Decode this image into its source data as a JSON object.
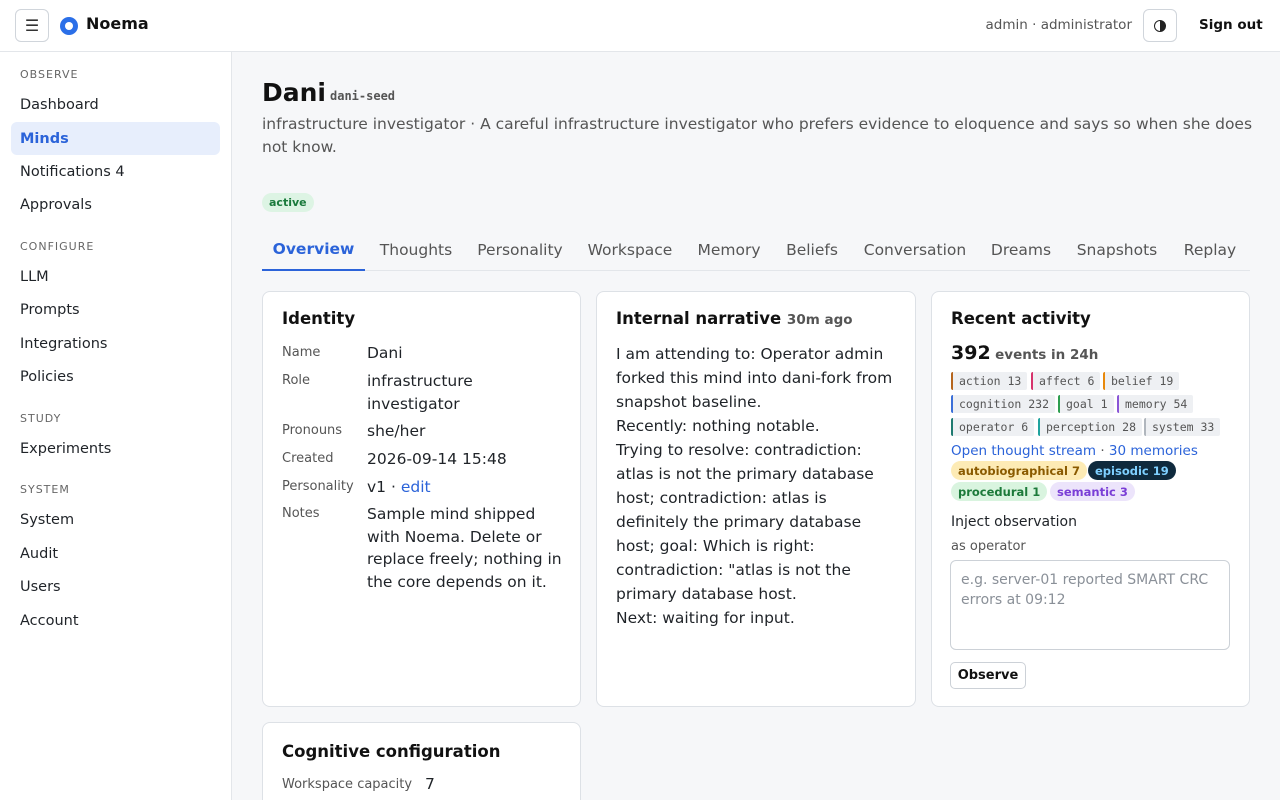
{
  "header": {
    "menu_glyph": "☰",
    "brand": "Noema",
    "user": "admin · administrator",
    "sign_out": "Sign out"
  },
  "sidebar": {
    "sections": [
      "OBSERVE",
      "CONFIGURE",
      "STUDY",
      "SYSTEM"
    ],
    "items": [
      "Dashboard",
      "Minds",
      "Notifications 4",
      "Approvals",
      "LLM",
      "Prompts",
      "Integrations",
      "Policies",
      "Experiments",
      "System",
      "Audit",
      "Users",
      "Account"
    ],
    "active_item": "Minds"
  },
  "mind": {
    "name": "Dani",
    "slug": "dani-seed",
    "description": "infrastructure investigator · A careful infrastructure investigator who prefers evidence to eloquence and says so when she does not know.",
    "status": "active"
  },
  "tabs": [
    "Overview",
    "Thoughts",
    "Personality",
    "Workspace",
    "Memory",
    "Beliefs",
    "Conversation",
    "Dreams",
    "Snapshots",
    "Replay"
  ],
  "active_tab": "Overview",
  "identity": {
    "title": "Identity",
    "rows": [
      {
        "label": "Name",
        "value": "Dani"
      },
      {
        "label": "Role",
        "value": "infrastructure investigator"
      },
      {
        "label": "Pronouns",
        "value": "she/her"
      },
      {
        "label": "Created",
        "value": "2026-09-14 15:48"
      },
      {
        "label": "Personality",
        "value": "v1 · ",
        "link": "edit"
      },
      {
        "label": "Notes",
        "value": "Sample mind shipped with Noema. Delete or replace freely; nothing in the core depends on it."
      }
    ]
  },
  "narrative": {
    "title": "Internal narrative",
    "age": "30m ago",
    "lines": [
      "I am attending to: Operator admin forked this mind into dani-fork from snapshot baseline.",
      "Recently: nothing notable.",
      "Trying to resolve: contradiction: atlas is not the primary database host; contradiction: atlas is definitely the primary database host; goal: Which is right: contradiction: \"atlas is not the primary database host.",
      "Next: waiting for input."
    ]
  },
  "activity": {
    "title": "Recent activity",
    "count": "392",
    "count_label": "events in 24h",
    "event_kinds": [
      {
        "label": "action 13",
        "color": "#b5651d"
      },
      {
        "label": "affect 6",
        "color": "#d6336c"
      },
      {
        "label": "belief 19",
        "color": "#e8890c"
      },
      {
        "label": "cognition 232",
        "color": "#3b6fd8"
      },
      {
        "label": "goal 1",
        "color": "#2e9e4f"
      },
      {
        "label": "memory 54",
        "color": "#8a55d6"
      },
      {
        "label": "operator 6",
        "color": "#1f7a70"
      },
      {
        "label": "perception 28",
        "color": "#20a39e"
      },
      {
        "label": "system 33",
        "color": "#b0b6bd"
      }
    ],
    "thought_stream_link": "Open thought stream",
    "separator": " · ",
    "memories_link": "30 memories",
    "memory_types": [
      {
        "label": "autobiographical 7",
        "bg": "#fdebb5",
        "fg": "#8a5a00"
      },
      {
        "label": "episodic 19",
        "bg": "#0f2a3d",
        "fg": "#7fd0ff"
      },
      {
        "label": "procedural 1",
        "bg": "#d9f4df",
        "fg": "#1c7a3a"
      },
      {
        "label": "semantic 3",
        "bg": "#ece4fb",
        "fg": "#7a3ed6"
      }
    ],
    "inject_label": "Inject observation",
    "as_operator": "as operator",
    "observation_placeholder": "e.g. server-01 reported SMART CRC errors at 09:12",
    "observe_button": "Observe"
  },
  "cognitive": {
    "title": "Cognitive configuration",
    "rows": [
      {
        "label": "Workspace capacity",
        "value": "7"
      }
    ]
  }
}
